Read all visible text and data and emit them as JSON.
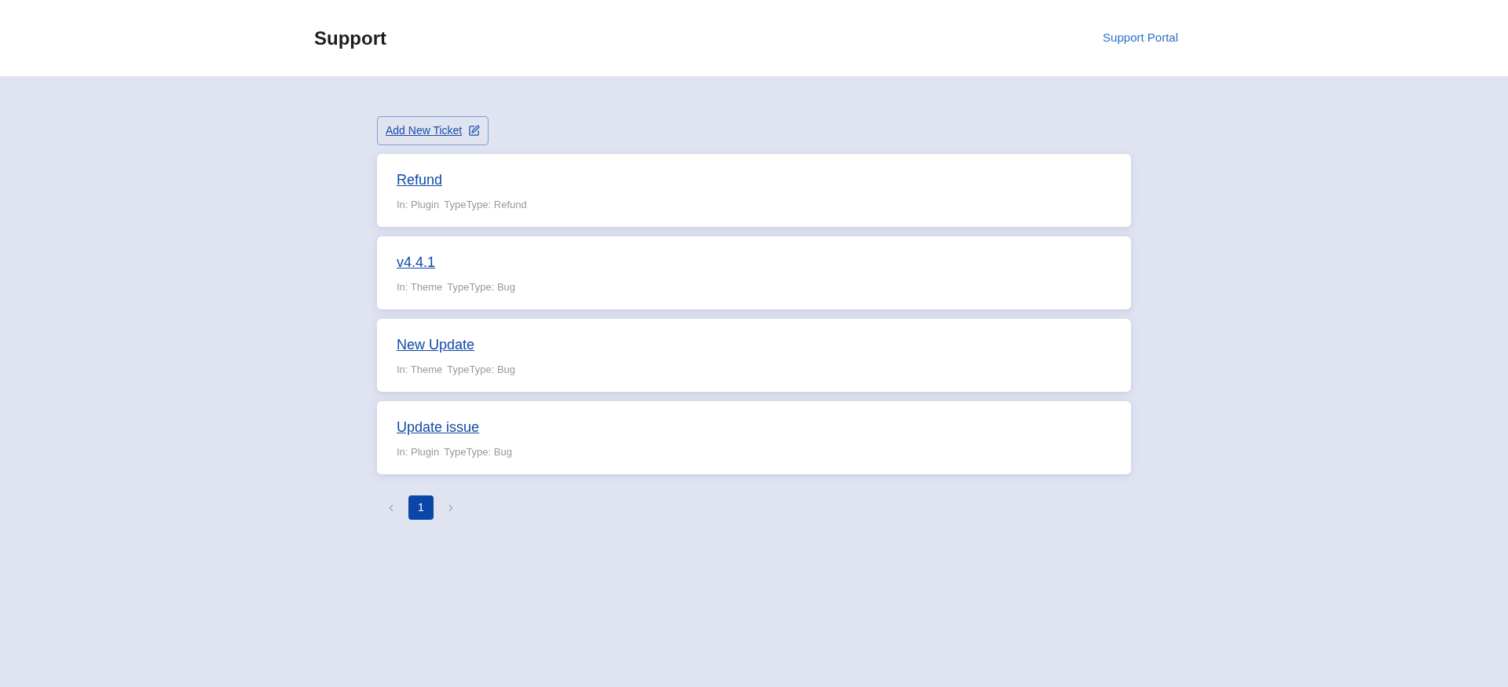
{
  "header": {
    "title": "Support",
    "link": "Support Portal"
  },
  "add_button": {
    "label": "Add New Ticket"
  },
  "tickets": [
    {
      "title": "Refund",
      "in": "In: Plugin",
      "type": "TypeType: Refund"
    },
    {
      "title": "v4.4.1",
      "in": "In: Theme",
      "type": "TypeType: Bug"
    },
    {
      "title": "New Update",
      "in": "In: Theme",
      "type": "TypeType: Bug"
    },
    {
      "title": "Update issue",
      "in": "In: Plugin",
      "type": "TypeType: Bug"
    }
  ],
  "pagination": {
    "prev": {
      "disabled": true
    },
    "pages": [
      {
        "label": "1",
        "selected": true
      }
    ],
    "next": {
      "disabled": true
    }
  }
}
